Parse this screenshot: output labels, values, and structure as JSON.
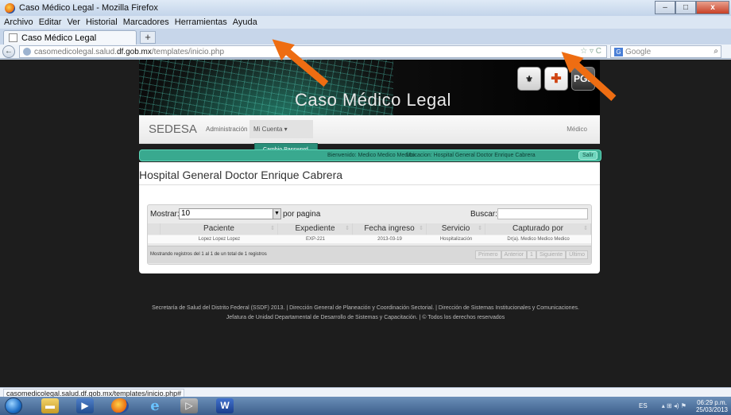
{
  "window": {
    "title": "Caso Médico Legal - Mozilla Firefox",
    "minimize": "–",
    "maximize": "□",
    "close": "x"
  },
  "menubar": [
    "Archivo",
    "Editar",
    "Ver",
    "Historial",
    "Marcadores",
    "Herramientas",
    "Ayuda"
  ],
  "tab": {
    "label": "Caso Médico Legal",
    "new_tab": "+"
  },
  "nav": {
    "back": "←",
    "url_prefix": "casomedicolegal.salud.",
    "url_domain": "df.gob.mx",
    "url_path": "/templates/inicio.php",
    "url_icons": "☆ ▿ C",
    "search_engine": "G",
    "search_placeholder": "Google",
    "search_icon": "⌕"
  },
  "banner": {
    "brand": "Caso Médico Legal",
    "logo_sedesa": "✚",
    "logo_pgj": "PGJ"
  },
  "appnav": {
    "brand": "SEDESA",
    "menu_admin": "Administración ▾",
    "menu_cuenta": "Mi Cuenta ▾",
    "role": "Médico",
    "dropdown_item": "Cambio Password"
  },
  "infobar": {
    "bienvenido": "Bienvenido: Medico Medico Medico",
    "ubicacion": "Ubicacion: Hospital General Doctor Enrique Cabrera",
    "salir": "Salir"
  },
  "content": {
    "hospital": "Hospital General Doctor Enrique Cabrera"
  },
  "table": {
    "mostrar": "Mostrar:",
    "page_size": "10",
    "por_pagina": "por pagina",
    "buscar": "Buscar:",
    "sort_icon": "⇕",
    "columns": [
      "Paciente",
      "Expediente",
      "Fecha ingreso",
      "Servicio",
      "Capturado por"
    ],
    "rows": [
      [
        "Lopez Lopez Lopez",
        "EXP-221",
        "2013-03-19",
        "Hospitalización",
        "Dr(a). Medico Medico Medico"
      ]
    ],
    "info": "Mostrando registros del 1 al 1 de un total de 1 registros",
    "pager": [
      "Primero",
      "Anterior",
      "1",
      "Siguiente",
      "Último"
    ]
  },
  "footer": {
    "line1": "Secretaría de Salud del Distrito Federal (SSDF) 2013.  |  Dirección General de Planeación y Coordinación Sectorial.  |  Dirección de Sistemas Institucionales y Comunicaciones.",
    "line2": "Jefatura de Unidad Departamental de Desarrollo de Sistemas y Capacitación.  |  © Todos los derechos reservados"
  },
  "statusbar": {
    "url": "casomedicolegal.salud.df.gob.mx/templates/inicio.php#"
  },
  "taskbar": {
    "lang": "ES",
    "tray_icons": "▴  ⊞  ◂)  ⚑",
    "time": "06:29 p.m.",
    "date": "25/03/2013",
    "word_label": "W",
    "ie_label": "e"
  },
  "colors": {
    "accent": "#39a98f",
    "arrow": "#ee6d12"
  }
}
